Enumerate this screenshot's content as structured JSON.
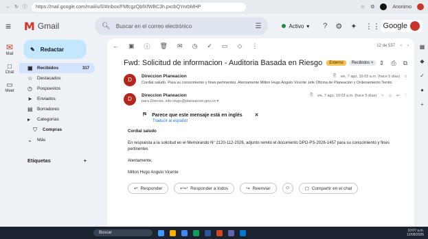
{
  "browser": {
    "url": "https://mail.google.com/mail/u/0/#inbox/FMfcgzQbfXfWBC3h.pxcbQYnrbMHP",
    "profile_label": "Anonimo"
  },
  "gmail": {
    "app_name": "Gmail",
    "search_placeholder": "Buscar en el correo electrónico",
    "status": "Activo",
    "google_label": "Google"
  },
  "rail": {
    "mail": "Mail",
    "chat": "Chat",
    "meet": "Meet"
  },
  "sidebar": {
    "compose": "Redactar",
    "items": [
      {
        "label": "Recibidos",
        "count": "317",
        "icon": "inbox-icon",
        "active": true
      },
      {
        "label": "Destacados",
        "count": "",
        "icon": "star-icon"
      },
      {
        "label": "Pospuestos",
        "count": "",
        "icon": "clock-icon"
      },
      {
        "label": "Enviados",
        "count": "",
        "icon": "send-icon"
      },
      {
        "label": "Borradores",
        "count": "",
        "icon": "draft-icon"
      },
      {
        "label": "Categorías",
        "count": "",
        "icon": "label-icon"
      },
      {
        "label": "Compras",
        "count": "",
        "icon": "shopping-icon"
      },
      {
        "label": "Más",
        "count": "",
        "icon": "chevron-down-icon"
      }
    ],
    "labels_header": "Etiquetas"
  },
  "toolbar": {
    "pager": "12 de 537"
  },
  "email": {
    "subject": "Fwd: Solicitud de informacion - Auditoria Basada en Riesgo",
    "tag_external": "Externo",
    "tag_inbox": "Recibidos ×",
    "messages": [
      {
        "sender": "Direccion Planeacion",
        "snippet": "Cordial saludo. Para su conocimiento y fines pertinentes. Atentamente Milton Hugo Angulo Vicente Jefe Oficina de Planeación y Ordenamiento Territo",
        "date": "vie, 7 ago, 10:03 a.m. (hace 5 días)"
      },
      {
        "sender": "Direccion Planeacion",
        "to": "para Director, info-Hugo@planeacion.gov.co ▾",
        "date": "vie, 7 ago, 10:03 a.m. (hace 5 días)"
      }
    ],
    "translate_prompt": "Parece que este mensaje está en inglés",
    "translate_link": "Traducir al español",
    "body": {
      "greeting": "Cordial saludo",
      "paragraph": "En respuesta a la solicitud en el Memorando N° 2120-112-2026, adjunto remito el documento DPO-PS-2026-1457 para su conocimiento y fines pertinentes",
      "closing": "Atentamente,",
      "signature": "Milton Hugo Angulo Vicente"
    },
    "actions": {
      "reply": "Responder",
      "reply_all": "Responder a todos",
      "forward": "Reenviar",
      "share_chat": "Compartir en el chat"
    }
  },
  "taskbar": {
    "search": "Buscar",
    "time": "10:07 a.m.",
    "date": "12/08/2026"
  },
  "colors": {
    "brand_red": "#d93025",
    "compose_bg": "#c2e7ff",
    "active_nav": "#d3e3fd",
    "tag_yellow": "#f7c453"
  }
}
